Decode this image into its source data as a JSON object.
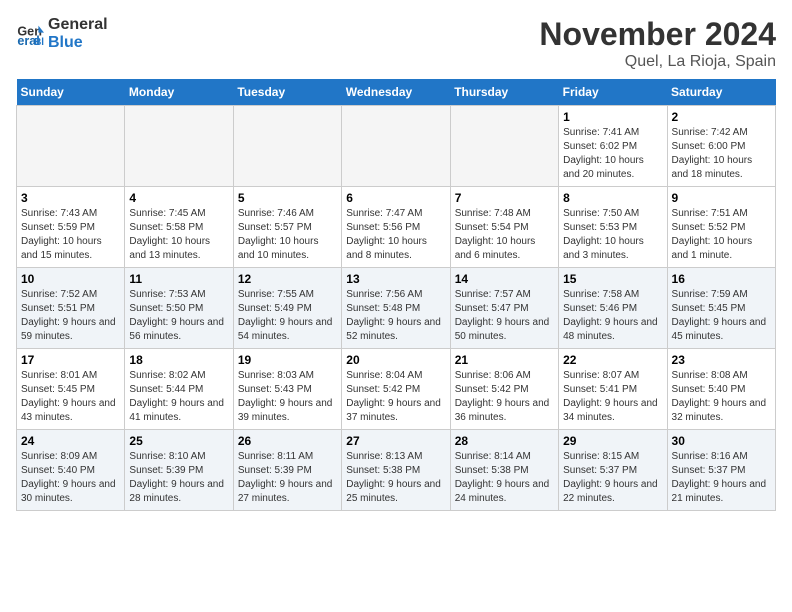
{
  "header": {
    "logo_line1": "General",
    "logo_line2": "Blue",
    "month": "November 2024",
    "location": "Quel, La Rioja, Spain"
  },
  "weekdays": [
    "Sunday",
    "Monday",
    "Tuesday",
    "Wednesday",
    "Thursday",
    "Friday",
    "Saturday"
  ],
  "weeks": [
    [
      {
        "day": "",
        "info": ""
      },
      {
        "day": "",
        "info": ""
      },
      {
        "day": "",
        "info": ""
      },
      {
        "day": "",
        "info": ""
      },
      {
        "day": "",
        "info": ""
      },
      {
        "day": "1",
        "info": "Sunrise: 7:41 AM\nSunset: 6:02 PM\nDaylight: 10 hours and 20 minutes."
      },
      {
        "day": "2",
        "info": "Sunrise: 7:42 AM\nSunset: 6:00 PM\nDaylight: 10 hours and 18 minutes."
      }
    ],
    [
      {
        "day": "3",
        "info": "Sunrise: 7:43 AM\nSunset: 5:59 PM\nDaylight: 10 hours and 15 minutes."
      },
      {
        "day": "4",
        "info": "Sunrise: 7:45 AM\nSunset: 5:58 PM\nDaylight: 10 hours and 13 minutes."
      },
      {
        "day": "5",
        "info": "Sunrise: 7:46 AM\nSunset: 5:57 PM\nDaylight: 10 hours and 10 minutes."
      },
      {
        "day": "6",
        "info": "Sunrise: 7:47 AM\nSunset: 5:56 PM\nDaylight: 10 hours and 8 minutes."
      },
      {
        "day": "7",
        "info": "Sunrise: 7:48 AM\nSunset: 5:54 PM\nDaylight: 10 hours and 6 minutes."
      },
      {
        "day": "8",
        "info": "Sunrise: 7:50 AM\nSunset: 5:53 PM\nDaylight: 10 hours and 3 minutes."
      },
      {
        "day": "9",
        "info": "Sunrise: 7:51 AM\nSunset: 5:52 PM\nDaylight: 10 hours and 1 minute."
      }
    ],
    [
      {
        "day": "10",
        "info": "Sunrise: 7:52 AM\nSunset: 5:51 PM\nDaylight: 9 hours and 59 minutes."
      },
      {
        "day": "11",
        "info": "Sunrise: 7:53 AM\nSunset: 5:50 PM\nDaylight: 9 hours and 56 minutes."
      },
      {
        "day": "12",
        "info": "Sunrise: 7:55 AM\nSunset: 5:49 PM\nDaylight: 9 hours and 54 minutes."
      },
      {
        "day": "13",
        "info": "Sunrise: 7:56 AM\nSunset: 5:48 PM\nDaylight: 9 hours and 52 minutes."
      },
      {
        "day": "14",
        "info": "Sunrise: 7:57 AM\nSunset: 5:47 PM\nDaylight: 9 hours and 50 minutes."
      },
      {
        "day": "15",
        "info": "Sunrise: 7:58 AM\nSunset: 5:46 PM\nDaylight: 9 hours and 48 minutes."
      },
      {
        "day": "16",
        "info": "Sunrise: 7:59 AM\nSunset: 5:45 PM\nDaylight: 9 hours and 45 minutes."
      }
    ],
    [
      {
        "day": "17",
        "info": "Sunrise: 8:01 AM\nSunset: 5:45 PM\nDaylight: 9 hours and 43 minutes."
      },
      {
        "day": "18",
        "info": "Sunrise: 8:02 AM\nSunset: 5:44 PM\nDaylight: 9 hours and 41 minutes."
      },
      {
        "day": "19",
        "info": "Sunrise: 8:03 AM\nSunset: 5:43 PM\nDaylight: 9 hours and 39 minutes."
      },
      {
        "day": "20",
        "info": "Sunrise: 8:04 AM\nSunset: 5:42 PM\nDaylight: 9 hours and 37 minutes."
      },
      {
        "day": "21",
        "info": "Sunrise: 8:06 AM\nSunset: 5:42 PM\nDaylight: 9 hours and 36 minutes."
      },
      {
        "day": "22",
        "info": "Sunrise: 8:07 AM\nSunset: 5:41 PM\nDaylight: 9 hours and 34 minutes."
      },
      {
        "day": "23",
        "info": "Sunrise: 8:08 AM\nSunset: 5:40 PM\nDaylight: 9 hours and 32 minutes."
      }
    ],
    [
      {
        "day": "24",
        "info": "Sunrise: 8:09 AM\nSunset: 5:40 PM\nDaylight: 9 hours and 30 minutes."
      },
      {
        "day": "25",
        "info": "Sunrise: 8:10 AM\nSunset: 5:39 PM\nDaylight: 9 hours and 28 minutes."
      },
      {
        "day": "26",
        "info": "Sunrise: 8:11 AM\nSunset: 5:39 PM\nDaylight: 9 hours and 27 minutes."
      },
      {
        "day": "27",
        "info": "Sunrise: 8:13 AM\nSunset: 5:38 PM\nDaylight: 9 hours and 25 minutes."
      },
      {
        "day": "28",
        "info": "Sunrise: 8:14 AM\nSunset: 5:38 PM\nDaylight: 9 hours and 24 minutes."
      },
      {
        "day": "29",
        "info": "Sunrise: 8:15 AM\nSunset: 5:37 PM\nDaylight: 9 hours and 22 minutes."
      },
      {
        "day": "30",
        "info": "Sunrise: 8:16 AM\nSunset: 5:37 PM\nDaylight: 9 hours and 21 minutes."
      }
    ]
  ]
}
